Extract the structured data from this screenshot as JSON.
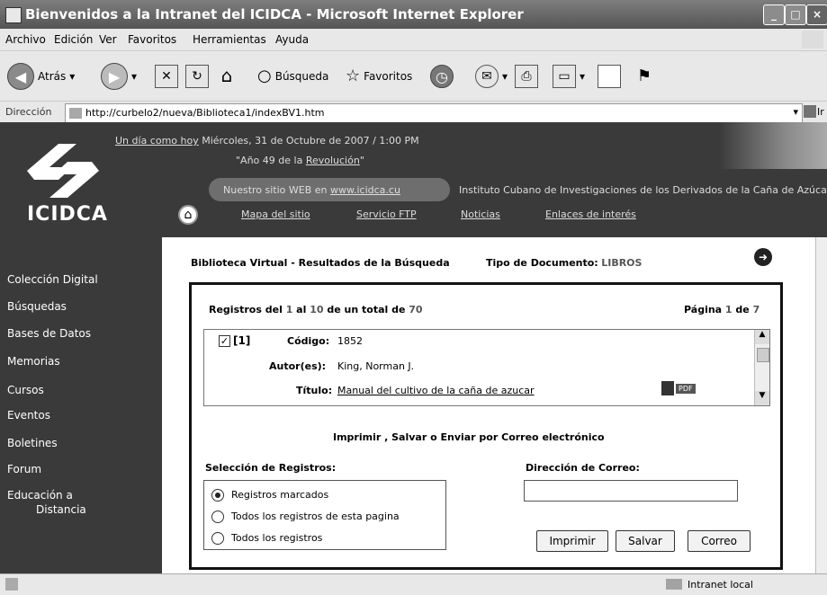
{
  "window": {
    "title": "Bienvenidos a la Intranet del ICIDCA - Microsoft Internet Explorer"
  },
  "menu": [
    "Archivo",
    "Edición",
    "Ver",
    "Favoritos",
    "Herramientas",
    "Ayuda"
  ],
  "toolbar": {
    "back_label": "Atrás",
    "search_label": "Búsqueda",
    "favorites_label": "Favoritos"
  },
  "address": {
    "label": "Dirección",
    "url": "http://curbelo2/nueva/Biblioteca1/indexBV1.htm",
    "go_label": "Ir"
  },
  "header": {
    "logo_text": "ICIDCA",
    "day_link": "Un día como hoy",
    "date": "Miércoles, 31 de Octubre de 2007 / 1:00 PM",
    "year_pre": "\"Año 49 de la ",
    "year_link": "Revolución",
    "year_post": "\"",
    "site_pre": "Nuestro sitio WEB en ",
    "site_link": "www.icidca.cu",
    "institute": "Instituto Cubano de Investigaciones de los Derivados de la Caña de Azúcar",
    "nav": [
      "Mapa del sitio",
      "Servicio FTP",
      "Noticias",
      "Enlaces de interés"
    ]
  },
  "sidebar": {
    "items": [
      "Colección Digital",
      "Búsquedas",
      "Bases de Datos",
      "Memorias",
      "Cursos",
      "Eventos",
      "Boletines",
      "Forum"
    ],
    "edu_line1": "Educación a",
    "edu_line2": "Distancia"
  },
  "main": {
    "heading": "Biblioteca Virtual - Resultados de la Búsqueda",
    "doc_type_label": "Tipo de Documento:",
    "doc_type_value": "LIBROS",
    "records_pre": "Registros del ",
    "records_from": "1",
    "records_mid1": " al ",
    "records_to": "10",
    "records_mid2": " de un total de ",
    "records_total": "70",
    "page_pre": "Página ",
    "page_current": "1",
    "page_mid": " de ",
    "page_total": "7",
    "record": {
      "index": "[1]",
      "code_label": "Código:",
      "code_value": "1852",
      "author_label": "Autor(es):",
      "author_value": "King, Norman J.",
      "title_label": "Título:",
      "title_value": "Manual del cultivo de la caña de azucar",
      "pdf_label": "PDF"
    },
    "actions_heading": "Imprimir , Salvar o Enviar por Correo electrónico",
    "selection_label": "Selección de Registros:",
    "email_label": "Dirección de Correo:",
    "email_value": "",
    "radios": [
      "Registros marcados",
      "Todos los registros de esta pagina",
      "Todos los registros"
    ],
    "buttons": {
      "print": "Imprimir",
      "save": "Salvar",
      "mail": "Correo"
    }
  },
  "status": {
    "zone": "Intranet local"
  }
}
